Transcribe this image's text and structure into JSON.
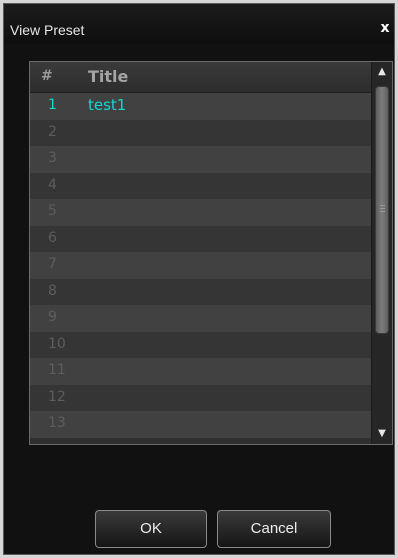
{
  "window": {
    "title": "View Preset",
    "close_label": "x"
  },
  "list": {
    "columns": [
      "#",
      "Title"
    ],
    "rows": [
      {
        "num": "1",
        "title": "test1",
        "active": true
      },
      {
        "num": "2",
        "title": ""
      },
      {
        "num": "3",
        "title": ""
      },
      {
        "num": "4",
        "title": ""
      },
      {
        "num": "5",
        "title": ""
      },
      {
        "num": "6",
        "title": ""
      },
      {
        "num": "7",
        "title": ""
      },
      {
        "num": "8",
        "title": ""
      },
      {
        "num": "9",
        "title": ""
      },
      {
        "num": "10",
        "title": ""
      },
      {
        "num": "11",
        "title": ""
      },
      {
        "num": "12",
        "title": ""
      },
      {
        "num": "13",
        "title": ""
      }
    ],
    "accent_color": "#14d8cf"
  },
  "scrollbar": {
    "up_icon": "arrow-up-icon",
    "down_icon": "arrow-down-icon",
    "grip_icon": "grip-icon",
    "up_glyph": "▲",
    "down_glyph": "▼"
  },
  "buttons": {
    "ok_label": "OK",
    "cancel_label": "Cancel"
  }
}
